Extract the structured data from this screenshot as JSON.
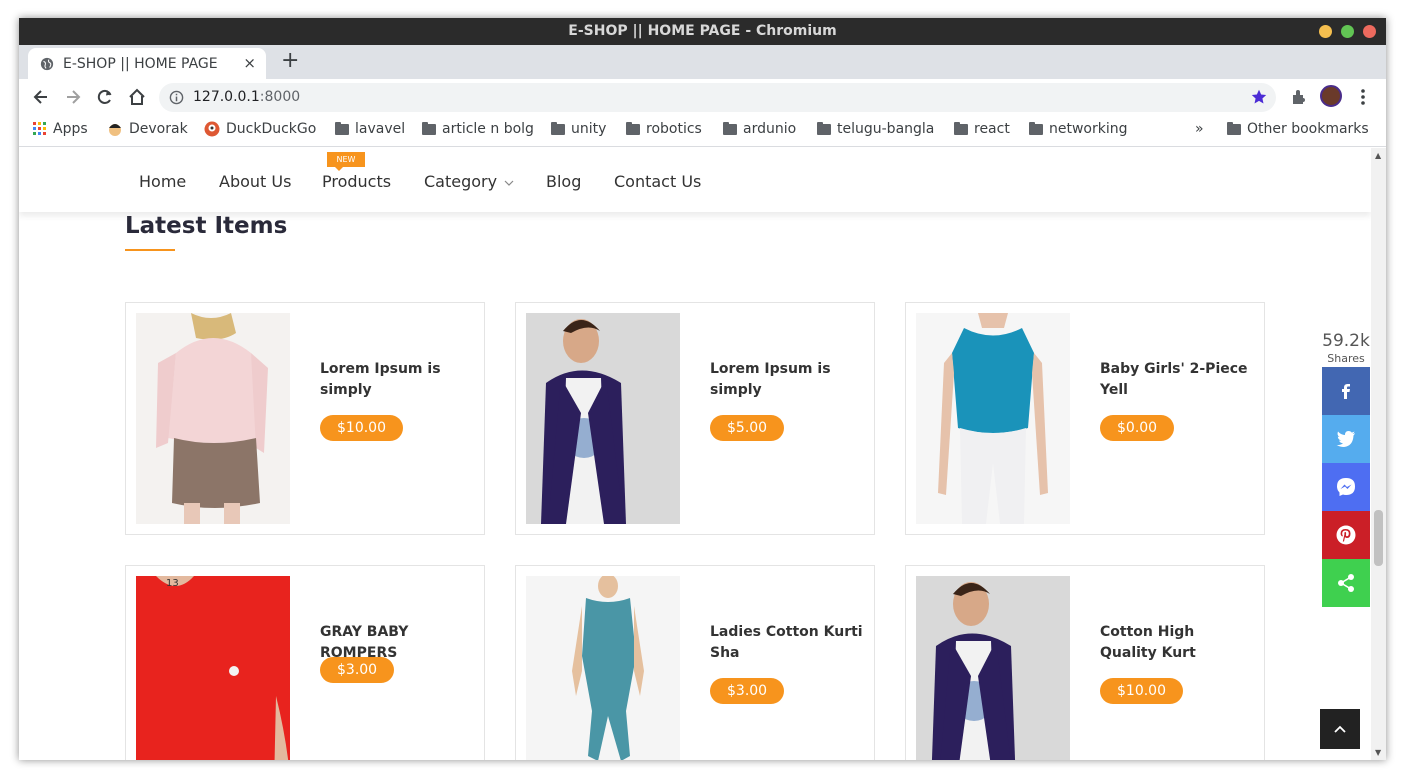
{
  "window": {
    "title": "E-SHOP || HOME PAGE - Chromium"
  },
  "tab": {
    "label": "E-SHOP || HOME PAGE",
    "close": "×",
    "new_tab": "+"
  },
  "omnibox": {
    "host": "127.0.0.1",
    "port": ":8000"
  },
  "bookmarks": [
    "Apps",
    "Devorak",
    "DuckDuckGo",
    "lavavel",
    "article n bolg",
    "unity",
    "robotics",
    "ardunio",
    "telugu-bangla",
    "react",
    "networking"
  ],
  "bookmarks_more": "»",
  "other_bookmarks": "Other bookmarks",
  "site_nav": {
    "links": [
      "Home",
      "About Us",
      "Products",
      "Category",
      "Blog",
      "Contact Us"
    ],
    "new_badge": "NEW"
  },
  "section": {
    "title": "Latest Items"
  },
  "products": [
    {
      "name": "Lorem Ipsum is simply",
      "price": "$10.00"
    },
    {
      "name": "Lorem Ipsum is simply",
      "price": "$5.00"
    },
    {
      "name": "Baby Girls' 2-Piece Yell",
      "price": "$0.00"
    },
    {
      "name": "GRAY BABY ROMPERS",
      "price": "$3.00"
    },
    {
      "name": "Ladies Cotton Kurti Sha",
      "price": "$3.00"
    },
    {
      "name": "Cotton High Quality Kurt",
      "price": "$10.00"
    }
  ],
  "share": {
    "count": "59.2k",
    "label": "Shares"
  },
  "colors": {
    "accent": "#f7941d",
    "facebook": "#4267b2",
    "twitter": "#55acee",
    "messenger": "#4e6ef2",
    "pinterest": "#cb1f27",
    "sharethis": "#3fd04f"
  }
}
